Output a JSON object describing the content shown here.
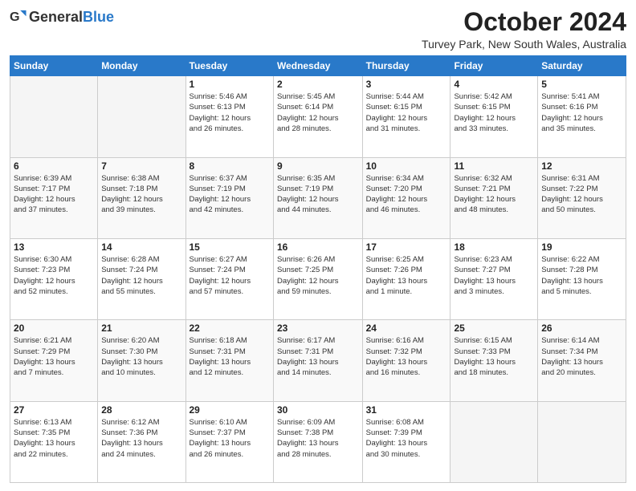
{
  "header": {
    "logo_general": "General",
    "logo_blue": "Blue",
    "month_title": "October 2024",
    "location": "Turvey Park, New South Wales, Australia"
  },
  "days_of_week": [
    "Sunday",
    "Monday",
    "Tuesday",
    "Wednesday",
    "Thursday",
    "Friday",
    "Saturday"
  ],
  "weeks": [
    [
      {
        "day": "",
        "info": ""
      },
      {
        "day": "",
        "info": ""
      },
      {
        "day": "1",
        "info": "Sunrise: 5:46 AM\nSunset: 6:13 PM\nDaylight: 12 hours\nand 26 minutes."
      },
      {
        "day": "2",
        "info": "Sunrise: 5:45 AM\nSunset: 6:14 PM\nDaylight: 12 hours\nand 28 minutes."
      },
      {
        "day": "3",
        "info": "Sunrise: 5:44 AM\nSunset: 6:15 PM\nDaylight: 12 hours\nand 31 minutes."
      },
      {
        "day": "4",
        "info": "Sunrise: 5:42 AM\nSunset: 6:15 PM\nDaylight: 12 hours\nand 33 minutes."
      },
      {
        "day": "5",
        "info": "Sunrise: 5:41 AM\nSunset: 6:16 PM\nDaylight: 12 hours\nand 35 minutes."
      }
    ],
    [
      {
        "day": "6",
        "info": "Sunrise: 6:39 AM\nSunset: 7:17 PM\nDaylight: 12 hours\nand 37 minutes."
      },
      {
        "day": "7",
        "info": "Sunrise: 6:38 AM\nSunset: 7:18 PM\nDaylight: 12 hours\nand 39 minutes."
      },
      {
        "day": "8",
        "info": "Sunrise: 6:37 AM\nSunset: 7:19 PM\nDaylight: 12 hours\nand 42 minutes."
      },
      {
        "day": "9",
        "info": "Sunrise: 6:35 AM\nSunset: 7:19 PM\nDaylight: 12 hours\nand 44 minutes."
      },
      {
        "day": "10",
        "info": "Sunrise: 6:34 AM\nSunset: 7:20 PM\nDaylight: 12 hours\nand 46 minutes."
      },
      {
        "day": "11",
        "info": "Sunrise: 6:32 AM\nSunset: 7:21 PM\nDaylight: 12 hours\nand 48 minutes."
      },
      {
        "day": "12",
        "info": "Sunrise: 6:31 AM\nSunset: 7:22 PM\nDaylight: 12 hours\nand 50 minutes."
      }
    ],
    [
      {
        "day": "13",
        "info": "Sunrise: 6:30 AM\nSunset: 7:23 PM\nDaylight: 12 hours\nand 52 minutes."
      },
      {
        "day": "14",
        "info": "Sunrise: 6:28 AM\nSunset: 7:24 PM\nDaylight: 12 hours\nand 55 minutes."
      },
      {
        "day": "15",
        "info": "Sunrise: 6:27 AM\nSunset: 7:24 PM\nDaylight: 12 hours\nand 57 minutes."
      },
      {
        "day": "16",
        "info": "Sunrise: 6:26 AM\nSunset: 7:25 PM\nDaylight: 12 hours\nand 59 minutes."
      },
      {
        "day": "17",
        "info": "Sunrise: 6:25 AM\nSunset: 7:26 PM\nDaylight: 13 hours\nand 1 minute."
      },
      {
        "day": "18",
        "info": "Sunrise: 6:23 AM\nSunset: 7:27 PM\nDaylight: 13 hours\nand 3 minutes."
      },
      {
        "day": "19",
        "info": "Sunrise: 6:22 AM\nSunset: 7:28 PM\nDaylight: 13 hours\nand 5 minutes."
      }
    ],
    [
      {
        "day": "20",
        "info": "Sunrise: 6:21 AM\nSunset: 7:29 PM\nDaylight: 13 hours\nand 7 minutes."
      },
      {
        "day": "21",
        "info": "Sunrise: 6:20 AM\nSunset: 7:30 PM\nDaylight: 13 hours\nand 10 minutes."
      },
      {
        "day": "22",
        "info": "Sunrise: 6:18 AM\nSunset: 7:31 PM\nDaylight: 13 hours\nand 12 minutes."
      },
      {
        "day": "23",
        "info": "Sunrise: 6:17 AM\nSunset: 7:31 PM\nDaylight: 13 hours\nand 14 minutes."
      },
      {
        "day": "24",
        "info": "Sunrise: 6:16 AM\nSunset: 7:32 PM\nDaylight: 13 hours\nand 16 minutes."
      },
      {
        "day": "25",
        "info": "Sunrise: 6:15 AM\nSunset: 7:33 PM\nDaylight: 13 hours\nand 18 minutes."
      },
      {
        "day": "26",
        "info": "Sunrise: 6:14 AM\nSunset: 7:34 PM\nDaylight: 13 hours\nand 20 minutes."
      }
    ],
    [
      {
        "day": "27",
        "info": "Sunrise: 6:13 AM\nSunset: 7:35 PM\nDaylight: 13 hours\nand 22 minutes."
      },
      {
        "day": "28",
        "info": "Sunrise: 6:12 AM\nSunset: 7:36 PM\nDaylight: 13 hours\nand 24 minutes."
      },
      {
        "day": "29",
        "info": "Sunrise: 6:10 AM\nSunset: 7:37 PM\nDaylight: 13 hours\nand 26 minutes."
      },
      {
        "day": "30",
        "info": "Sunrise: 6:09 AM\nSunset: 7:38 PM\nDaylight: 13 hours\nand 28 minutes."
      },
      {
        "day": "31",
        "info": "Sunrise: 6:08 AM\nSunset: 7:39 PM\nDaylight: 13 hours\nand 30 minutes."
      },
      {
        "day": "",
        "info": ""
      },
      {
        "day": "",
        "info": ""
      }
    ]
  ]
}
